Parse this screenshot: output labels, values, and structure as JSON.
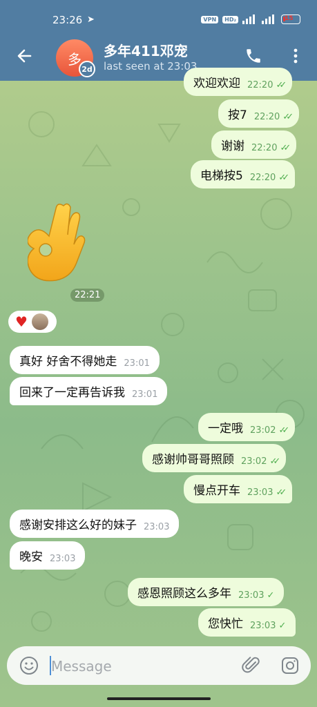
{
  "status": {
    "time": "23:26",
    "vpn": "VPN",
    "hd": "HD₂",
    "battery": "15"
  },
  "header": {
    "avatar_letter": "多",
    "story_badge": "2d",
    "title": "多年411邓宠",
    "subtitle": "last seen at 23:03"
  },
  "messages": [
    {
      "dir": "out",
      "text": "欢迎欢迎",
      "time": "22:20",
      "status": "read"
    },
    {
      "dir": "out",
      "text": "按7",
      "time": "22:20",
      "status": "read"
    },
    {
      "dir": "out",
      "text": "谢谢",
      "time": "22:20",
      "status": "read"
    },
    {
      "dir": "out",
      "text": "电梯按5",
      "time": "22:20",
      "status": "read"
    },
    {
      "dir": "in",
      "sticker": "ok-hand",
      "time": "22:21"
    },
    {
      "dir": "in",
      "reaction": "heart"
    },
    {
      "dir": "in",
      "text": "真好 好舍不得她走",
      "time": "23:01"
    },
    {
      "dir": "in",
      "text": "回来了一定再告诉我",
      "time": "23:01"
    },
    {
      "dir": "out",
      "text": "一定哦",
      "time": "23:02",
      "status": "read"
    },
    {
      "dir": "out",
      "text": "感谢帅哥哥照顾",
      "time": "23:02",
      "status": "read"
    },
    {
      "dir": "out",
      "text": "慢点开车",
      "time": "23:03",
      "status": "read"
    },
    {
      "dir": "in",
      "text": "感谢安排这么好的妹子",
      "time": "23:03"
    },
    {
      "dir": "in",
      "text": "晚安",
      "time": "23:03"
    },
    {
      "dir": "out",
      "text": "感恩照顾这么多年",
      "time": "23:03",
      "status": "sent"
    },
    {
      "dir": "out",
      "text": "您快忙",
      "time": "23:03",
      "status": "sent"
    }
  ],
  "composer": {
    "placeholder": "Message"
  },
  "colors": {
    "header": "#517da2",
    "outgoing_bubble": "#eefcdc",
    "incoming_bubble": "#ffffff",
    "check": "#4fae4e"
  },
  "icons": [
    "back-arrow-icon",
    "phone-icon",
    "more-vertical-icon",
    "emoji-icon",
    "paperclip-icon",
    "camera-icon",
    "heart-icon",
    "ok-hand-sticker"
  ]
}
